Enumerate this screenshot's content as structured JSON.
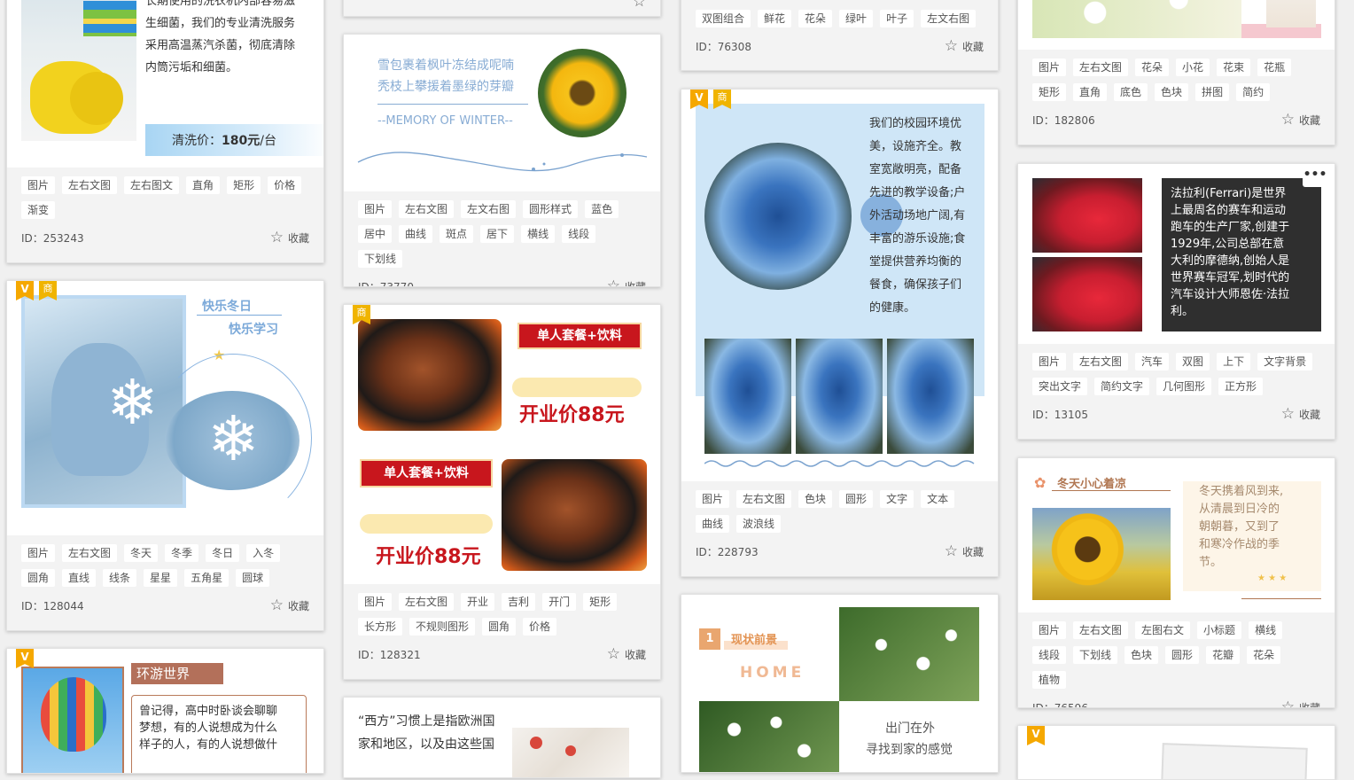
{
  "cards": {
    "c1": {
      "text_lines": [
        "长期使用的洗衣机内部容易滋",
        "生细菌，我们的专业清洗服务",
        "采用高温蒸汽杀菌，彻底清除",
        "内筒污垢和细菌。"
      ],
      "price_label": "清洗价：",
      "price_value": "180元",
      "price_unit": "/台",
      "tags": [
        "图片",
        "左右文图",
        "左右图文",
        "直角",
        "矩形",
        "价格",
        "渐变"
      ],
      "id": "ID：253243",
      "fav": "收藏"
    },
    "c2": {
      "badges": [
        "V",
        "商"
      ],
      "title1": "快乐冬日",
      "title2": "快乐学习",
      "tags": [
        "图片",
        "左右文图",
        "冬天",
        "冬季",
        "冬日",
        "入冬",
        "圆角",
        "直线",
        "线条",
        "星星",
        "五角星",
        "圆球"
      ],
      "id": "ID：128044",
      "fav": "收藏"
    },
    "c3": {
      "badge": "V",
      "title": "环游世界",
      "text_lines": [
        "曾记得，高中时卧谈会聊聊",
        "梦想，有的人说想成为什么",
        "样子的人，有的人说想做什"
      ]
    },
    "c4": {
      "tags": []
    },
    "c5": {
      "line1": "雪包裹着枫叶冻结成呢喃",
      "line2": "秃枝上攀援着墨绿的芽瓣",
      "memo": "--MEMORY OF WINTER--",
      "tags": [
        "图片",
        "左右文图",
        "左文右图",
        "圆形样式",
        "蓝色",
        "居中",
        "曲线",
        "斑点",
        "居下",
        "横线",
        "线段",
        "下划线"
      ],
      "id": "ID：73770",
      "fav": "收藏"
    },
    "c6": {
      "badge": "商",
      "combo": "单人套餐+饮料",
      "price": "开业价88元",
      "tags": [
        "图片",
        "左右文图",
        "开业",
        "吉利",
        "开门",
        "矩形",
        "长方形",
        "不规则图形",
        "圆角",
        "价格"
      ],
      "id": "ID：128321",
      "fav": "收藏"
    },
    "c7": {
      "text_lines": [
        "“西方”习惯上是指欧洲国",
        "家和地区，以及由这些国"
      ]
    },
    "c8": {
      "tags": [
        "双图组合",
        "鲜花",
        "花朵",
        "绿叶",
        "叶子",
        "左文右图"
      ],
      "id": "ID：76308",
      "fav": "收藏"
    },
    "c9": {
      "badges": [
        "V",
        "商"
      ],
      "text_lines": [
        "我们的校园环境优",
        "美，设施齐全。教",
        "室宽敞明亮，配备",
        "先进的教学设备;户",
        "外活动场地广阔,有",
        "丰富的游乐设施;食",
        "堂提供营养均衡的",
        "餐食，确保孩子们",
        "的健康。"
      ],
      "tags": [
        "图片",
        "左右文图",
        "色块",
        "圆形",
        "文字",
        "文本",
        "曲线",
        "波浪线"
      ],
      "id": "ID：228793",
      "fav": "收藏"
    },
    "c10": {
      "num": "1",
      "title": "现状前景",
      "home": "HOME",
      "cap1": "出门在外",
      "cap2": "寻找到家的感觉"
    },
    "c11": {
      "tags": [
        "图片",
        "左右文图",
        "花朵",
        "小花",
        "花束",
        "花瓶",
        "矩形",
        "直角",
        "底色",
        "色块",
        "拼图",
        "简约"
      ],
      "id": "ID：182806",
      "fav": "收藏"
    },
    "c12": {
      "more": "•••",
      "text_lines": [
        "法拉利(Ferrari)是世界",
        "上最周名的赛车和运动",
        "跑车的生产厂家,创建于",
        "1929年,公司总部在意",
        "大利的摩德纳,创始人是",
        "世界赛车冠军,划时代的",
        "汽车设计大师恩佐·法拉",
        "利。"
      ],
      "tags": [
        "图片",
        "左右文图",
        "汽车",
        "双图",
        "上下",
        "文字背景",
        "突出文字",
        "简约文字",
        "几何图形",
        "正方形"
      ],
      "id": "ID：13105",
      "fav": "收藏"
    },
    "c13": {
      "title": "冬天小心着凉",
      "text_lines": [
        "冬天携着风到来,",
        "从清晨到日冷的",
        "朝朝暮，又到了",
        "和寒冷作战的季",
        "节。"
      ],
      "tags": [
        "图片",
        "左右文图",
        "左图右文",
        "小标题",
        "横线",
        "线段",
        "下划线",
        "色块",
        "圆形",
        "花瓣",
        "花朵",
        "植物"
      ],
      "id": "ID：76596",
      "fav": "收藏"
    },
    "c14": {
      "badge": "V"
    }
  },
  "colors": {
    "badge": "#f5a800",
    "red": "#c8161d",
    "blue_light": "#cfe6f7",
    "dark": "#2f2f2f"
  }
}
